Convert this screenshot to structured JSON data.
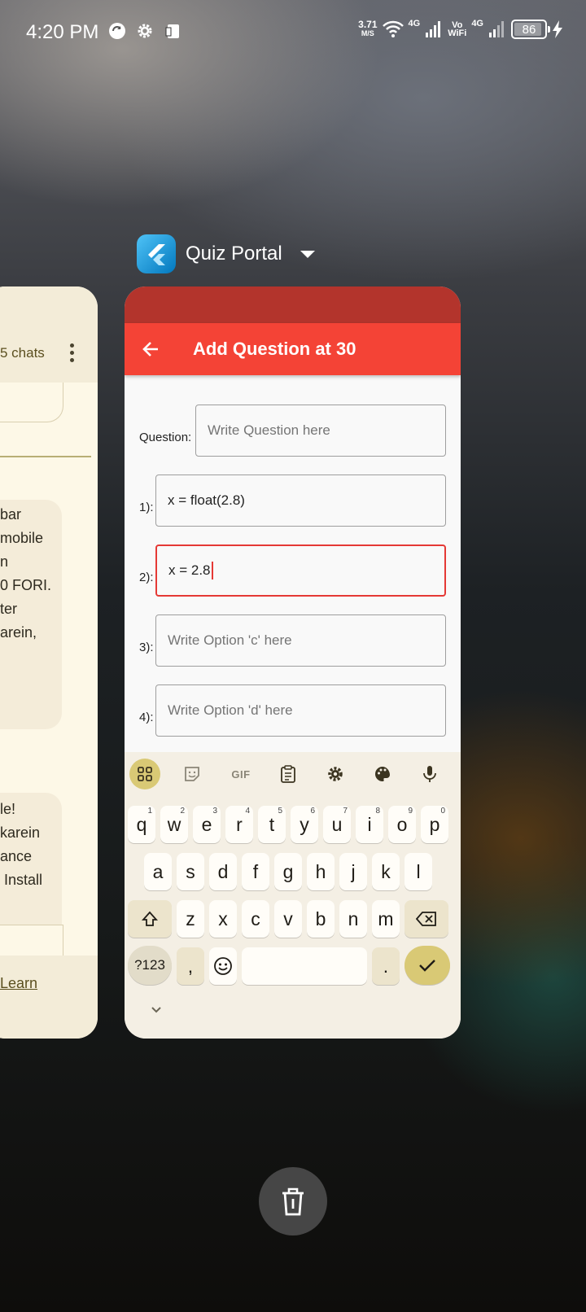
{
  "status_bar": {
    "time": "4:20 PM",
    "net_speed_value": "3.71",
    "net_speed_unit": "M/S",
    "sim1_label": "4G",
    "vowifi_top": "Vo",
    "vowifi_bottom": "WiFi",
    "sim2_label": "4G",
    "battery": "86"
  },
  "app_switcher": {
    "app_title": "Quiz Portal",
    "left_card": {
      "chats_label": "5 chats",
      "msg1": "bar\nmobile\nn\n0 FORI.\nter\narein,",
      "msg2": "le!\nkarein\nance\n Install",
      "learn": "Learn"
    }
  },
  "quiz_app": {
    "appbar_title": "Add Question at 30",
    "question_label": "Question:",
    "question_placeholder": "Write Question here",
    "options": [
      {
        "label": "1):",
        "value": "x = float(2.8)"
      },
      {
        "label": "2):",
        "value": "x = 2.8"
      },
      {
        "label": "3):",
        "placeholder": "Write Option 'c' here"
      },
      {
        "label": "4):",
        "placeholder": "Write Option 'd' here"
      }
    ]
  },
  "keyboard": {
    "toolbar": [
      "apps-icon",
      "sticker-icon",
      "GIF",
      "clipboard-icon",
      "settings-icon",
      "palette-icon",
      "mic-icon"
    ],
    "row1": [
      {
        "k": "q",
        "h": "1"
      },
      {
        "k": "w",
        "h": "2"
      },
      {
        "k": "e",
        "h": "3"
      },
      {
        "k": "r",
        "h": "4"
      },
      {
        "k": "t",
        "h": "5"
      },
      {
        "k": "y",
        "h": "6"
      },
      {
        "k": "u",
        "h": "7"
      },
      {
        "k": "i",
        "h": "8"
      },
      {
        "k": "o",
        "h": "9"
      },
      {
        "k": "p",
        "h": "0"
      }
    ],
    "row2": [
      "a",
      "s",
      "d",
      "f",
      "g",
      "h",
      "j",
      "k",
      "l"
    ],
    "row3": [
      "z",
      "x",
      "c",
      "v",
      "b",
      "n",
      "m"
    ],
    "sym_key": "?123",
    "comma_key": ",",
    "period_key": "."
  },
  "colors": {
    "appbar": "#f44336",
    "status_strip": "#b3342c",
    "focus_border": "#e53935",
    "keyboard_accent": "#d9c975"
  }
}
